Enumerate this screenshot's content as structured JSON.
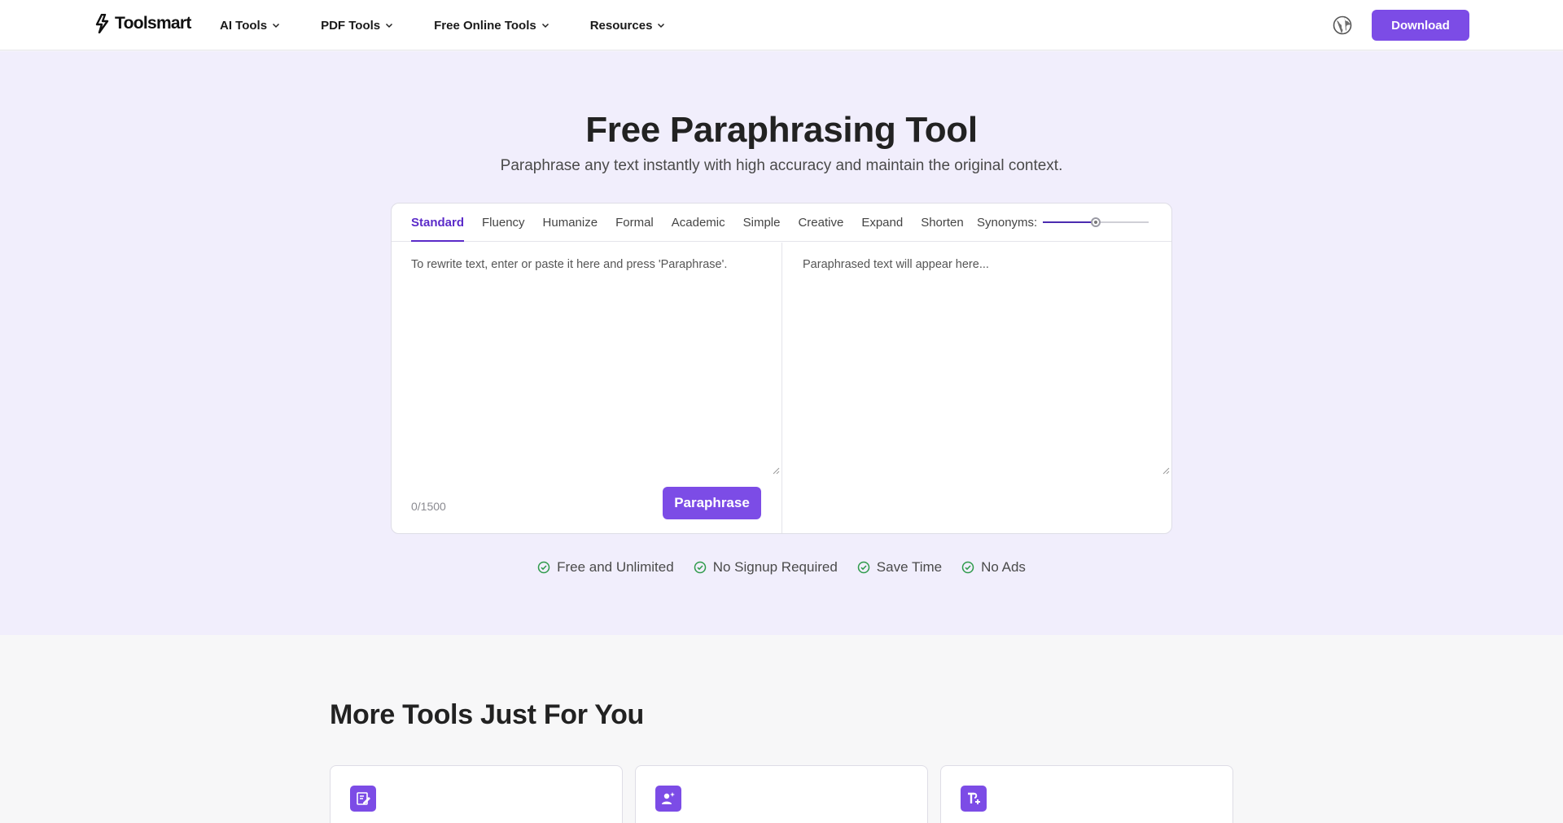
{
  "header": {
    "logo_text": "Toolsmart",
    "nav": [
      {
        "label": "AI Tools"
      },
      {
        "label": "PDF Tools"
      },
      {
        "label": "Free Online Tools"
      },
      {
        "label": "Resources"
      }
    ],
    "download_label": "Download",
    "icons": {
      "logo": "lightning-logo-icon",
      "language": "globe-icon",
      "dropdown": "chevron-down-icon"
    }
  },
  "hero": {
    "title": "Free Paraphrasing Tool",
    "subtitle": "Paraphrase any text instantly with high accuracy and maintain the original context."
  },
  "tool": {
    "modes": [
      "Standard",
      "Fluency",
      "Humanize",
      "Formal",
      "Academic",
      "Simple",
      "Creative",
      "Expand",
      "Shorten"
    ],
    "active_mode": "Standard",
    "synonyms_label": "Synonyms:",
    "synonyms_level": 0.5,
    "input_placeholder": "To rewrite text, enter or paste it here and press 'Paraphrase'.",
    "output_placeholder": "Paraphrased text will appear here...",
    "char_count": "0/1500",
    "paraphrase_label": "Paraphrase"
  },
  "features": [
    "Free and Unlimited",
    "No Signup Required",
    "Save Time",
    "No Ads"
  ],
  "more_tools": {
    "title": "More Tools Just For You",
    "tiles": [
      {
        "icon": "edit-document-icon"
      },
      {
        "icon": "user-sparkle-icon"
      },
      {
        "icon": "text-paragraph-plus-icon"
      }
    ]
  },
  "colors": {
    "accent": "#7c4ce6",
    "active_tab": "#5b2bc9",
    "hero_bg": "#f1eefc",
    "check_green": "#2e9a4a"
  }
}
